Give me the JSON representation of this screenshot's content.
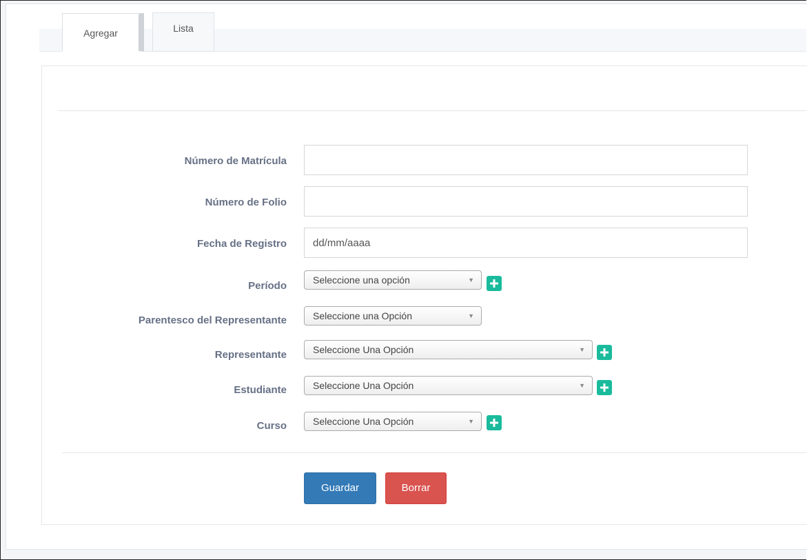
{
  "tabs": [
    {
      "label": "Agregar",
      "active": true
    },
    {
      "label": "Lista",
      "active": false
    }
  ],
  "form": {
    "matricula": {
      "label": "Número de Matrícula",
      "value": ""
    },
    "folio": {
      "label": "Número de Folio",
      "value": ""
    },
    "fecha": {
      "label": "Fecha de Registro",
      "placeholder": "dd/mm/aaaa"
    },
    "periodo": {
      "label": "Período",
      "selected": "Seleccione una opción"
    },
    "parentesco": {
      "label": "Parentesco del Representante",
      "selected": "Seleccione una Opción"
    },
    "representante": {
      "label": "Representante",
      "selected": "Seleccione Una Opción"
    },
    "estudiante": {
      "label": "Estudiante",
      "selected": "Seleccione Una Opción"
    },
    "curso": {
      "label": "Curso",
      "selected": "Seleccione Una Opción"
    }
  },
  "actions": {
    "save_label": "Guardar",
    "clear_label": "Borrar"
  },
  "colors": {
    "add_button": "#1abb9c",
    "primary": "#337ab7",
    "danger": "#d9534f",
    "label": "#667085"
  },
  "icons": {
    "add": "plus-icon",
    "dropdown": "caret-down-icon"
  }
}
